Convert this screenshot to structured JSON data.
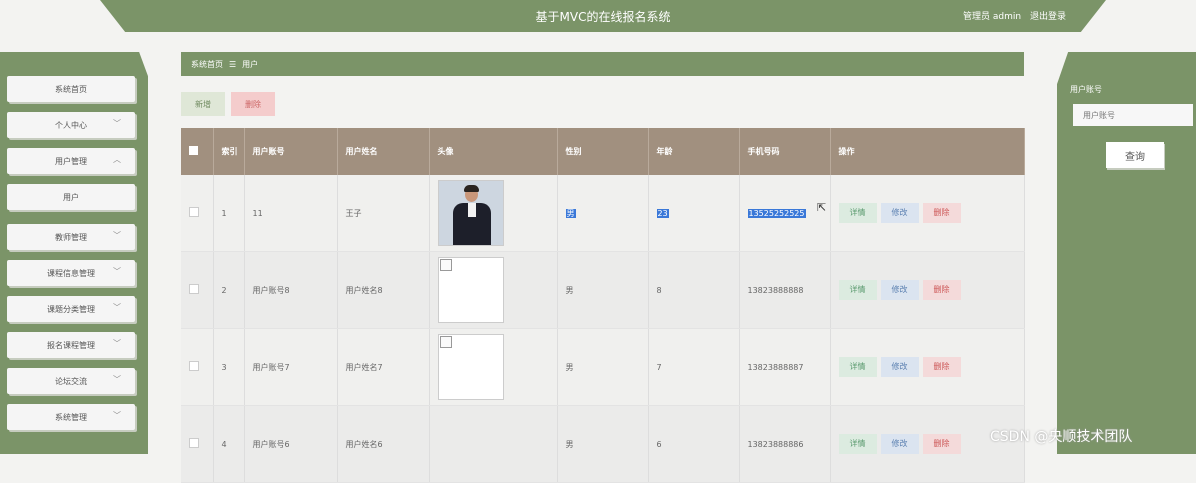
{
  "header": {
    "title": "基于MVC的在线报名系统",
    "admin": "管理员 admin",
    "logout": "退出登录"
  },
  "sidebar": {
    "items": [
      {
        "label": "系统首页",
        "chevron": ""
      },
      {
        "label": "个人中心",
        "chevron": "﹀"
      },
      {
        "label": "用户管理",
        "chevron": "︿"
      },
      {
        "label": "用户",
        "chevron": ""
      },
      {
        "label": "教师管理",
        "chevron": "﹀"
      },
      {
        "label": "课程信息管理",
        "chevron": "﹀"
      },
      {
        "label": "课题分类管理",
        "chevron": "﹀"
      },
      {
        "label": "报名课程管理",
        "chevron": "﹀"
      },
      {
        "label": "论坛交流",
        "chevron": "﹀"
      },
      {
        "label": "系统管理",
        "chevron": "﹀"
      }
    ]
  },
  "breadcrumb": {
    "home": "系统首页",
    "sep": "☰",
    "current": "用户"
  },
  "toolbar": {
    "add": "新增",
    "delete": "删除"
  },
  "table": {
    "headers": [
      "",
      "索引",
      "用户账号",
      "用户姓名",
      "头像",
      "性别",
      "年龄",
      "手机号码",
      "操作"
    ],
    "rows": [
      {
        "index": "1",
        "account": "11",
        "name": "王子",
        "gender": "男",
        "age": "23",
        "phone": "13525252525"
      },
      {
        "index": "2",
        "account": "用户账号8",
        "name": "用户姓名8",
        "gender": "男",
        "age": "8",
        "phone": "13823888888"
      },
      {
        "index": "3",
        "account": "用户账号7",
        "name": "用户姓名7",
        "gender": "男",
        "age": "7",
        "phone": "13823888887"
      },
      {
        "index": "4",
        "account": "用户账号6",
        "name": "用户姓名6",
        "gender": "男",
        "age": "6",
        "phone": "13823888886"
      }
    ],
    "actions": {
      "view": "详情",
      "edit": "修改",
      "delete": "删除"
    }
  },
  "search": {
    "label": "用户账号",
    "placeholder": "用户账号",
    "button": "查询"
  },
  "watermark": "CSDN @央顺技术团队"
}
